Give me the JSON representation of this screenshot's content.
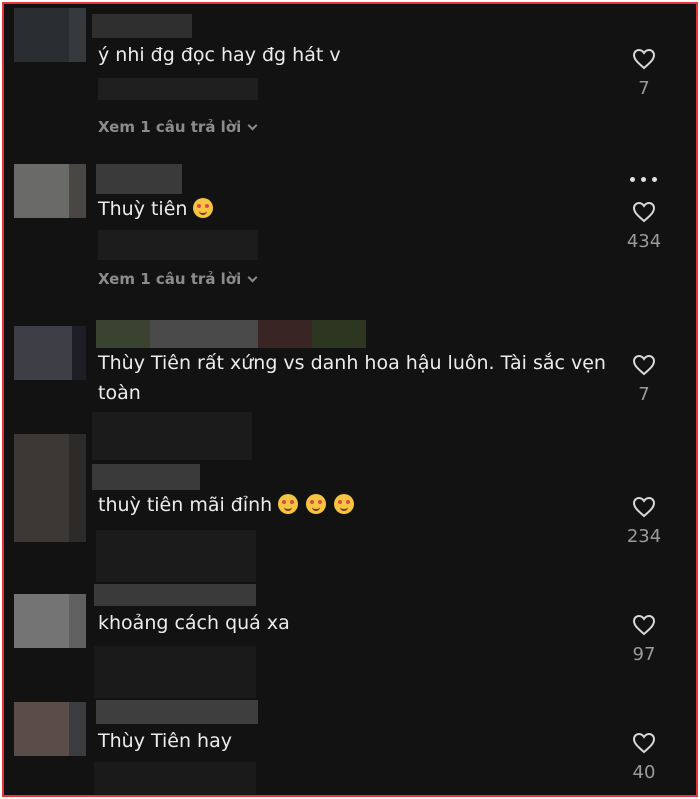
{
  "theme": {
    "background": "#121212",
    "border": "#e8343e",
    "text": "#ececec",
    "muted": "#8c8c8c"
  },
  "comments": [
    {
      "text": "ý nhi đg đọc hay đg hát v",
      "likes": "7",
      "reply_label": "Xem 1 câu trả lời",
      "emoji_count": 0
    },
    {
      "text": "Thuỳ tiên",
      "likes": "434",
      "reply_label": "Xem 1 câu trả lời",
      "emoji_count": 1
    },
    {
      "text": "Thùy Tiên rất xứng vs danh hoa hậu luôn. Tài sắc vẹn toàn",
      "likes": "7",
      "emoji_count": 0
    },
    {
      "text": "thuỳ tiên mãi đỉnh",
      "likes": "234",
      "emoji_count": 3
    },
    {
      "text": "khoảng cách quá xa",
      "likes": "97",
      "emoji_count": 0
    },
    {
      "text": "Thùy Tiên hay",
      "likes": "40",
      "emoji_count": 0
    }
  ],
  "icons": {
    "like": "heart-outline-icon",
    "more": "more-dots-icon",
    "expand": "chevron-down-icon",
    "emoji": "smiling-face-hearts-emoji"
  }
}
